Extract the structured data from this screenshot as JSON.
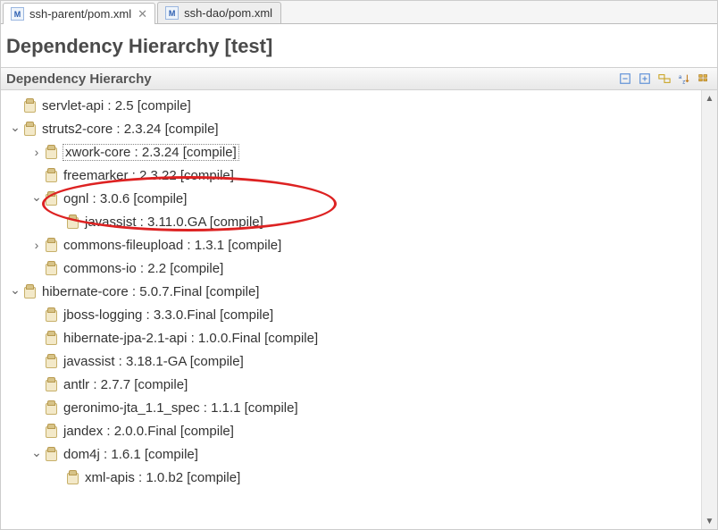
{
  "tabs": [
    {
      "label": "ssh-parent/pom.xml",
      "active": true
    },
    {
      "label": "ssh-dao/pom.xml",
      "active": false
    }
  ],
  "heading": "Dependency Hierarchy [test]",
  "panel_title": "Dependency Hierarchy",
  "toolbar": {
    "collapse": "Collapse All",
    "expand": "Expand All",
    "link": "Link with Editor",
    "sort": "Sort",
    "filter": "Filter"
  },
  "tree": [
    {
      "depth": 0,
      "twisty": "",
      "label": "servlet-api : 2.5 [compile]"
    },
    {
      "depth": 0,
      "twisty": "v",
      "label": "struts2-core : 2.3.24 [compile]"
    },
    {
      "depth": 1,
      "twisty": ">",
      "label": "xwork-core : 2.3.24 [compile]",
      "boxed": true
    },
    {
      "depth": 1,
      "twisty": "",
      "label": "freemarker : 2.3.22 [compile]"
    },
    {
      "depth": 1,
      "twisty": "v",
      "label": "ognl : 3.0.6 [compile]"
    },
    {
      "depth": 2,
      "twisty": "",
      "label": "javassist : 3.11.0.GA [compile]"
    },
    {
      "depth": 1,
      "twisty": ">",
      "label": "commons-fileupload : 1.3.1 [compile]"
    },
    {
      "depth": 1,
      "twisty": "",
      "label": "commons-io : 2.2 [compile]"
    },
    {
      "depth": 0,
      "twisty": "v",
      "label": "hibernate-core : 5.0.7.Final [compile]"
    },
    {
      "depth": 1,
      "twisty": "",
      "label": "jboss-logging : 3.3.0.Final [compile]"
    },
    {
      "depth": 1,
      "twisty": "",
      "label": "hibernate-jpa-2.1-api : 1.0.0.Final [compile]"
    },
    {
      "depth": 1,
      "twisty": "",
      "label": "javassist : 3.18.1-GA [compile]"
    },
    {
      "depth": 1,
      "twisty": "",
      "label": "antlr : 2.7.7 [compile]"
    },
    {
      "depth": 1,
      "twisty": "",
      "label": "geronimo-jta_1.1_spec : 1.1.1 [compile]"
    },
    {
      "depth": 1,
      "twisty": "",
      "label": "jandex : 2.0.0.Final [compile]"
    },
    {
      "depth": 1,
      "twisty": "v",
      "label": "dom4j : 1.6.1 [compile]"
    },
    {
      "depth": 2,
      "twisty": "",
      "label": "xml-apis : 1.0.b2 [compile]"
    }
  ]
}
